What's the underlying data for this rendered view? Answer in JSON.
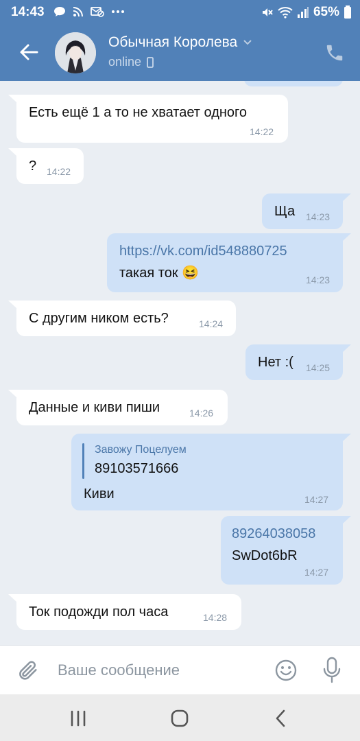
{
  "status_bar": {
    "time": "14:43",
    "battery": "65%",
    "icons_left": [
      "chat-bubble-icon",
      "rss-icon",
      "mail-blocked-icon",
      "more-dots-icon"
    ],
    "icons_right": [
      "mute-icon",
      "wifi-icon",
      "signal-icon"
    ]
  },
  "header": {
    "title": "Обычная Королева",
    "status": "online",
    "icons": [
      "back-arrow-icon",
      "chevron-down-icon",
      "phone-mobile-icon",
      "phone-icon"
    ]
  },
  "messages": [
    {
      "dir": "in",
      "text": "Есть ещё 1 а то не хватает одного",
      "time": "14:22"
    },
    {
      "dir": "in",
      "text": "?",
      "time": "14:22"
    },
    {
      "dir": "out",
      "text": "Ща",
      "time": "14:23"
    },
    {
      "dir": "out",
      "link": "https://vk.com/id548880725",
      "text": "такая ток 😆",
      "time": "14:23"
    },
    {
      "dir": "in",
      "text": "С другим ником есть?",
      "time": "14:24"
    },
    {
      "dir": "out",
      "text": "Нет :(",
      "time": "14:25"
    },
    {
      "dir": "in",
      "text": "Данные и киви пиши",
      "time": "14:26"
    },
    {
      "dir": "out",
      "reply": {
        "author": "Завожу Поцелуем",
        "text": "89103571666"
      },
      "text": "Киви",
      "time": "14:27"
    },
    {
      "dir": "out",
      "link": "89264038058",
      "text": "SwDot6bR",
      "time": "14:27"
    },
    {
      "dir": "in",
      "text": "Ток подожди пол часа",
      "time": "14:28"
    }
  ],
  "input": {
    "placeholder": "Ваше сообщение",
    "icons": [
      "paperclip-icon",
      "emoji-icon",
      "microphone-icon"
    ]
  },
  "colors": {
    "header_bg": "#5181b8",
    "chat_bg": "#eaeef3",
    "incoming_bubble": "#ffffff",
    "outgoing_bubble": "#cfe1f7",
    "link": "#4a76a8"
  },
  "navbar": {
    "icons": [
      "recent-apps-icon",
      "home-icon",
      "back-icon"
    ]
  }
}
